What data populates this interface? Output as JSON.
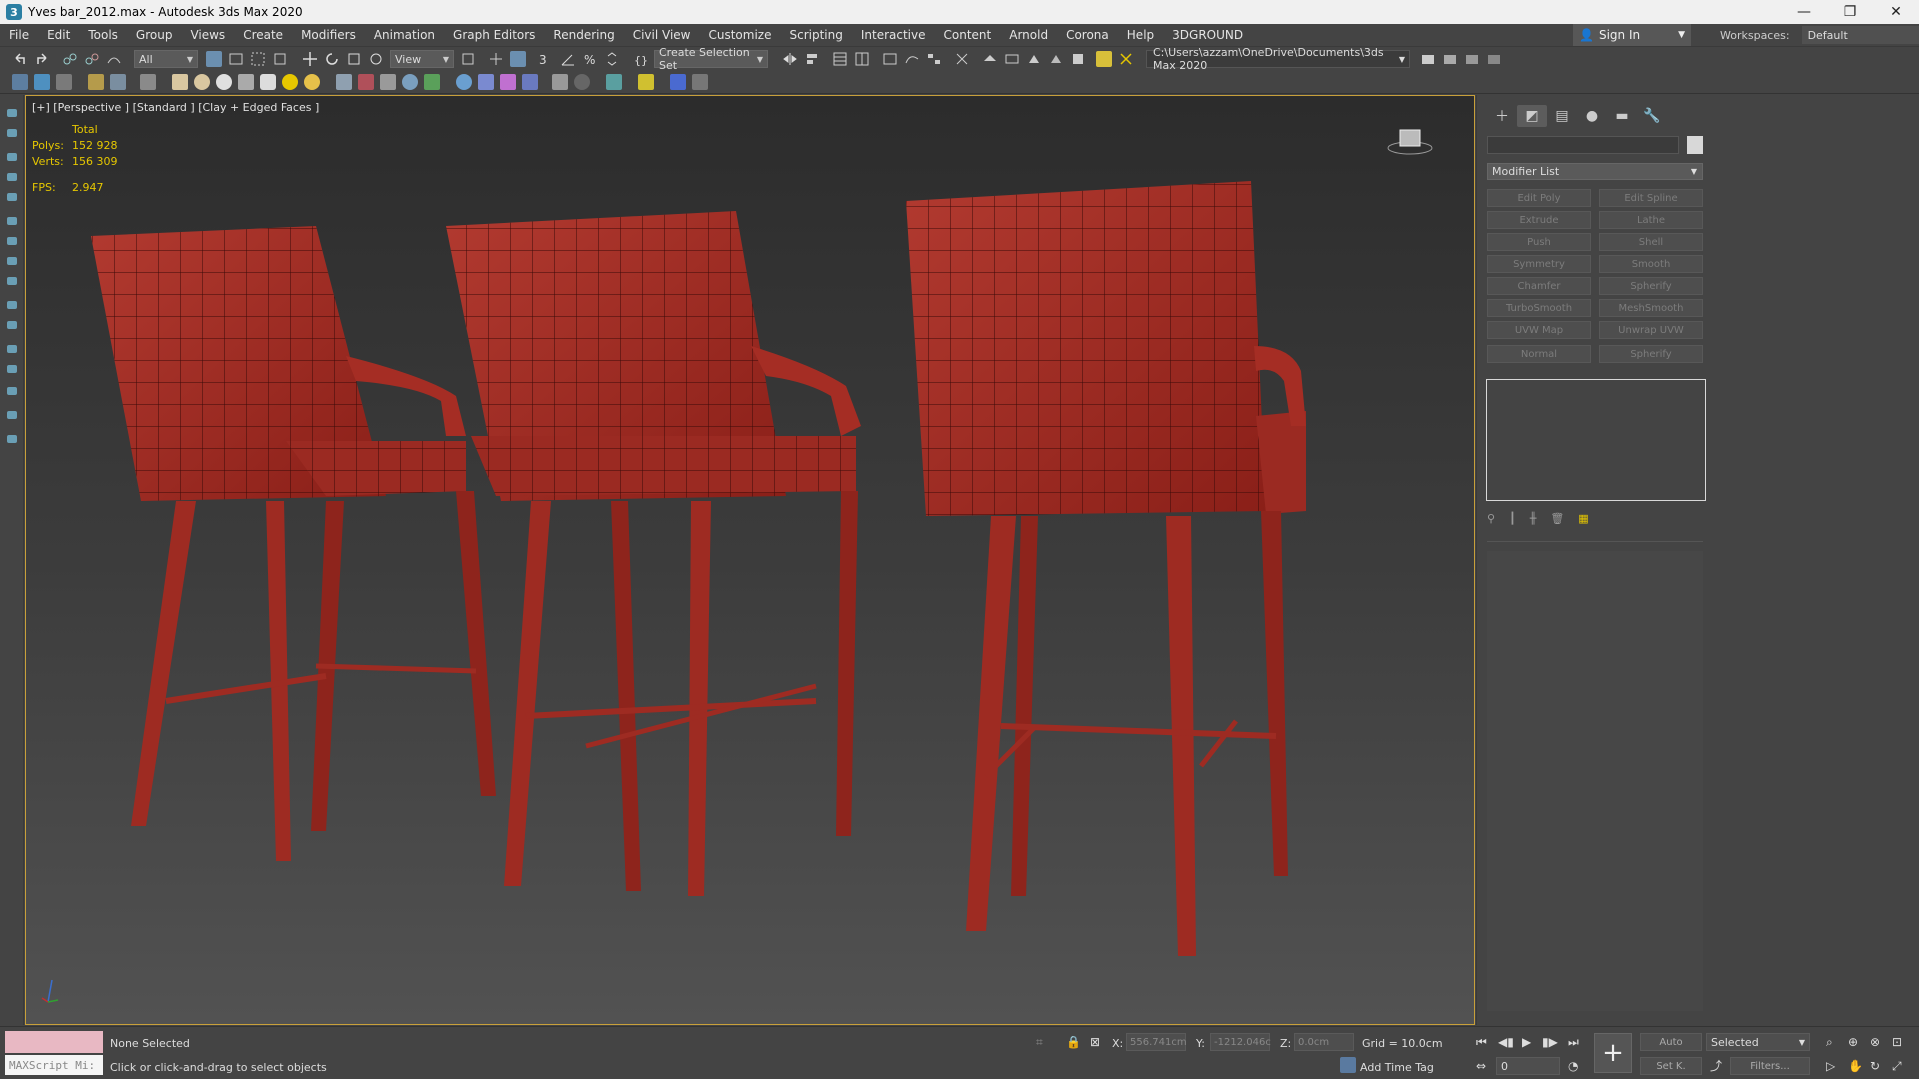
{
  "window": {
    "title": "Yves bar_2012.max - Autodesk 3ds Max 2020",
    "app_icon_glyph": "3",
    "minimize": "—",
    "maximize": "❐",
    "close": "✕"
  },
  "menu": [
    "File",
    "Edit",
    "Tools",
    "Group",
    "Views",
    "Create",
    "Modifiers",
    "Animation",
    "Graph Editors",
    "Rendering",
    "Civil View",
    "Customize",
    "Scripting",
    "Interactive",
    "Content",
    "Arnold",
    "Corona",
    "Help",
    "3DGROUND"
  ],
  "signin": {
    "label": "Sign In"
  },
  "workspaces": {
    "label": "Workspaces:",
    "value": "Default"
  },
  "toolbar": {
    "selection_filter": "All",
    "ref_coord": "View",
    "selection_set": "Create Selection Set",
    "project_path": "C:\\Users\\azzam\\OneDrive\\Documents\\3ds Max 2020"
  },
  "viewport": {
    "label": "[+] [Perspective ] [Standard ] [Clay + Edged Faces ]",
    "stats": {
      "total_label": "Total",
      "polys_label": "Polys:",
      "polys_value": "152 928",
      "verts_label": "Verts:",
      "verts_value": "156 309",
      "fps_label": "FPS:",
      "fps_value": "2.947"
    }
  },
  "command_panel": {
    "modifier_list": "Modifier List",
    "modifier_buttons": [
      "Edit Poly",
      "Edit Spline",
      "Extrude",
      "Lathe",
      "Push",
      "Shell",
      "Symmetry",
      "Smooth",
      "Chamfer",
      "Spherify",
      "TurboSmooth",
      "MeshSmooth",
      "UVW Map",
      "Unwrap UVW",
      "Normal",
      "Spherify"
    ]
  },
  "status": {
    "maxscript_label": "MAXScript Mi:",
    "selection": "None Selected",
    "hint": "Click or click-and-drag to select objects",
    "x_label": "X:",
    "x_value": "556.741cm",
    "y_label": "Y:",
    "y_value": "-1212.046c",
    "z_label": "Z:",
    "z_value": "0.0cm",
    "grid": "Grid = 10.0cm",
    "add_time_tag": "Add Time Tag",
    "auto": "Auto",
    "set_key": "Set K.",
    "selected": "Selected",
    "filters": "Filters...",
    "frame": "0"
  }
}
